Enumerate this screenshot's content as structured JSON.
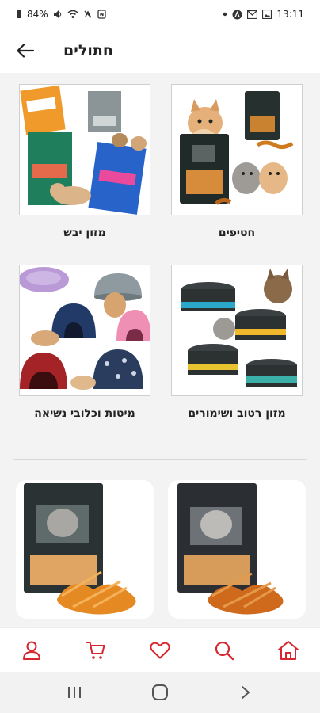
{
  "status_bar": {
    "battery": "84%",
    "time": "13:11"
  },
  "header": {
    "title": "חתולים"
  },
  "categories": [
    {
      "label": "חטיפים"
    },
    {
      "label": "מזון יבש"
    },
    {
      "label": "מזון רטוב ושימורים"
    },
    {
      "label": "מיטות וכלובי נשיאה"
    }
  ],
  "theme": {
    "accent": "#d7262f",
    "nav_icon_color": "#d7262f"
  },
  "bottom_nav": {
    "items": [
      "profile-icon",
      "cart-icon",
      "heart-icon",
      "search-icon",
      "home-icon"
    ]
  }
}
